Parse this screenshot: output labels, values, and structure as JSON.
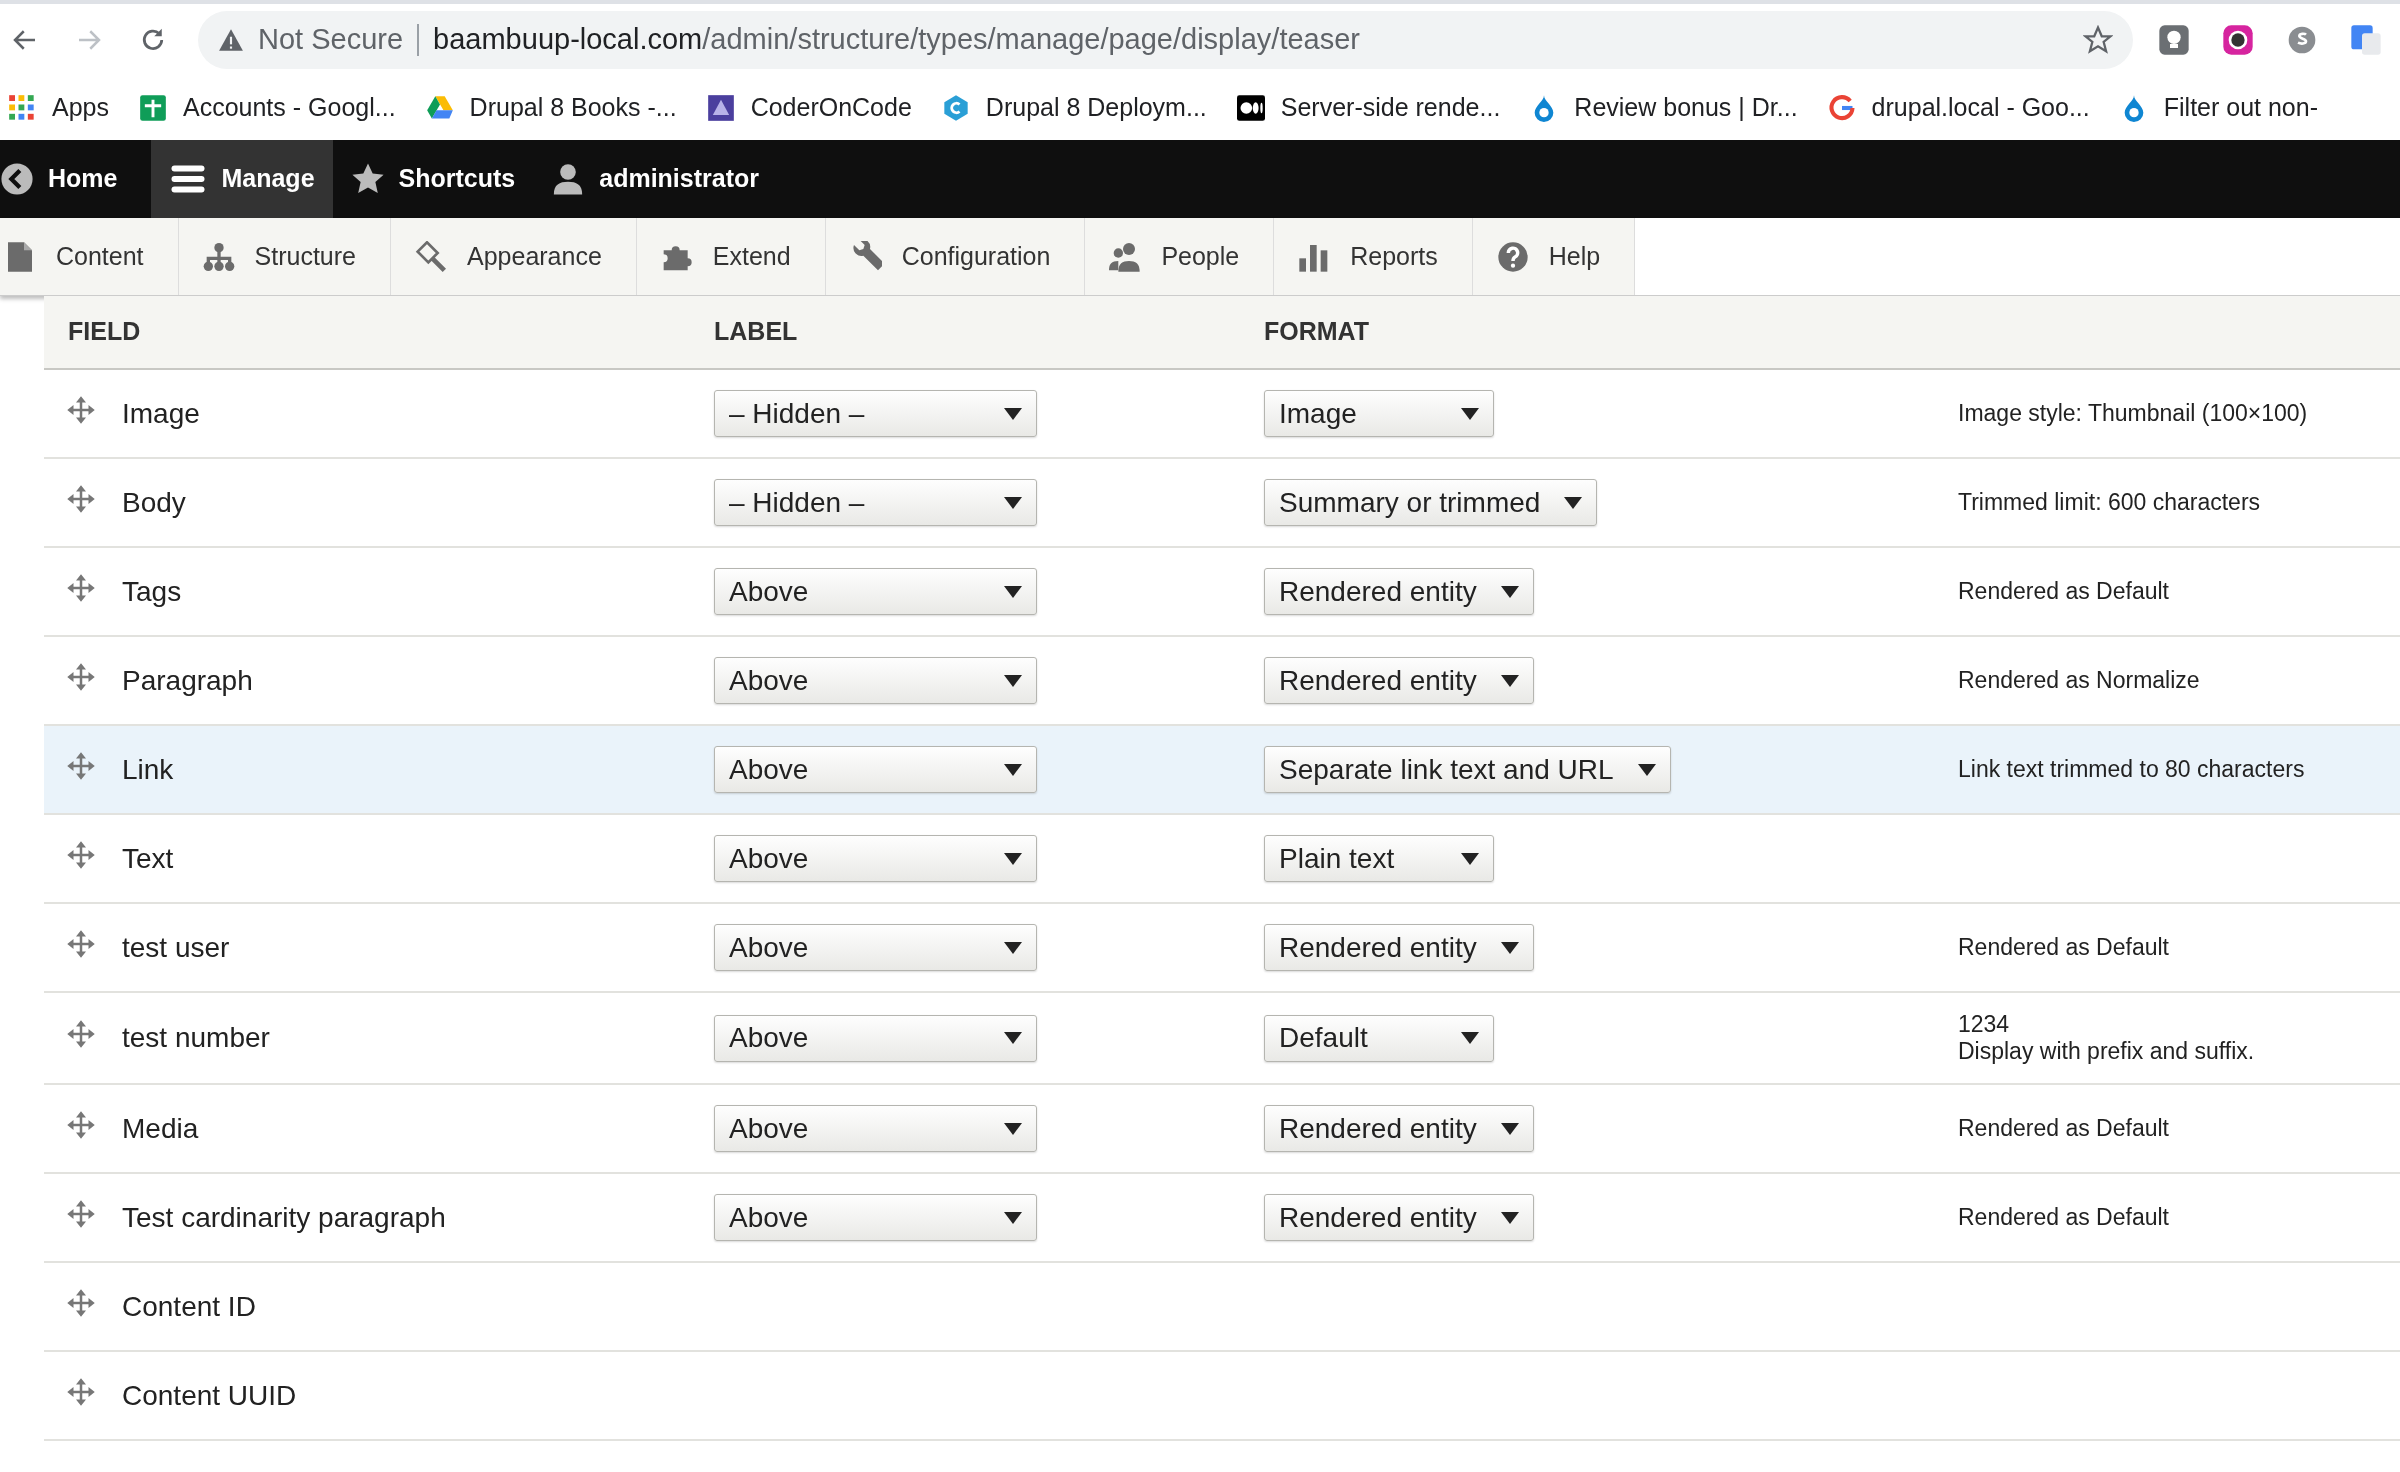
{
  "browser": {
    "security": "Not Secure",
    "url_host": "baambuup-local.com",
    "url_path": "/admin/structure/types/manage/page/display/teaser"
  },
  "bookmarks": [
    {
      "label": "Apps",
      "kind": "apps"
    },
    {
      "label": "Accounts - Googl...",
      "kind": "sheets"
    },
    {
      "label": "Drupal 8 Books -...",
      "kind": "drive"
    },
    {
      "label": "CoderOnCode",
      "kind": "coder"
    },
    {
      "label": "Drupal 8 Deploym...",
      "kind": "hex"
    },
    {
      "label": "Server-side rende...",
      "kind": "medium"
    },
    {
      "label": "Review bonus | Dr...",
      "kind": "drop"
    },
    {
      "label": "drupal.local - Goo...",
      "kind": "google"
    },
    {
      "label": "Filter out non-",
      "kind": "drop"
    }
  ],
  "toolbar": [
    {
      "label": "Home",
      "kind": "home",
      "selected": false
    },
    {
      "label": "Manage",
      "kind": "manage",
      "selected": true
    },
    {
      "label": "Shortcuts",
      "kind": "shortcuts",
      "selected": false
    },
    {
      "label": "administrator",
      "kind": "user",
      "selected": false
    }
  ],
  "tray": [
    {
      "label": "Content",
      "kind": "content"
    },
    {
      "label": "Structure",
      "kind": "structure"
    },
    {
      "label": "Appearance",
      "kind": "appearance"
    },
    {
      "label": "Extend",
      "kind": "extend"
    },
    {
      "label": "Configuration",
      "kind": "configuration"
    },
    {
      "label": "People",
      "kind": "people"
    },
    {
      "label": "Reports",
      "kind": "reports"
    },
    {
      "label": "Help",
      "kind": "help"
    }
  ],
  "table": {
    "columns": [
      "FIELD",
      "LABEL",
      "FORMAT"
    ],
    "rows": [
      {
        "field": "Image",
        "label": "– Hidden –",
        "format": "Image",
        "summary": [
          "Image style: Thumbnail (100×100)"
        ],
        "highlighted": false
      },
      {
        "field": "Body",
        "label": "– Hidden –",
        "format": "Summary or trimmed",
        "summary": [
          "Trimmed limit: 600 characters"
        ],
        "highlighted": false
      },
      {
        "field": "Tags",
        "label": "Above",
        "format": "Rendered entity",
        "summary": [
          "Rendered as Default"
        ],
        "highlighted": false
      },
      {
        "field": "Paragraph",
        "label": "Above",
        "format": "Rendered entity",
        "summary": [
          "Rendered as Normalize"
        ],
        "highlighted": false
      },
      {
        "field": "Link",
        "label": "Above",
        "format": "Separate link text and URL",
        "summary": [
          "Link text trimmed to 80 characters"
        ],
        "highlighted": true
      },
      {
        "field": "Text",
        "label": "Above",
        "format": "Plain text",
        "highlighted": false
      },
      {
        "field": "test user",
        "label": "Above",
        "format": "Rendered entity",
        "summary": [
          "Rendered as Default"
        ],
        "highlighted": false
      },
      {
        "field": "test number",
        "label": "Above",
        "format": "Default",
        "summary": [
          "1234",
          "Display with prefix and suffix."
        ],
        "highlighted": false
      },
      {
        "field": "Media",
        "label": "Above",
        "format": "Rendered entity",
        "summary": [
          "Rendered as Default"
        ],
        "highlighted": false
      },
      {
        "field": "Test cardinarity paragraph",
        "label": "Above",
        "format": "Rendered entity",
        "summary": [
          "Rendered as Default"
        ],
        "highlighted": false
      },
      {
        "field": "Content ID",
        "highlighted": false
      },
      {
        "field": "Content UUID",
        "highlighted": false
      }
    ]
  }
}
